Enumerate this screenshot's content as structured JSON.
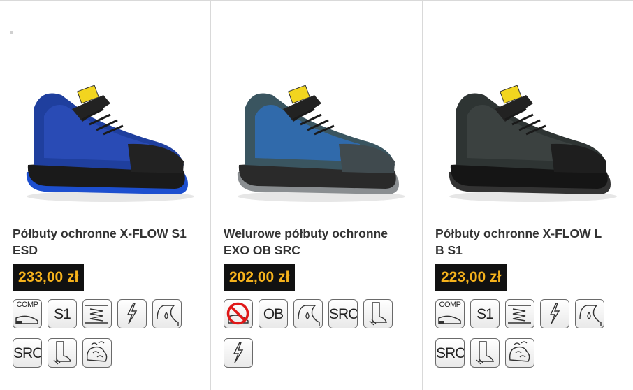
{
  "products": [
    {
      "title_line1": "Półbuty ochronne X-FLOW S1",
      "title_line2": "ESD",
      "price": "233,00 zł",
      "shoe_colors": {
        "upper": "#1f3f9e",
        "mesh": "#2b4db8",
        "sole": "#1a1a1a",
        "accent": "#1d4fcf",
        "toe": "#222222"
      },
      "icons": [
        {
          "name": "comp-toe-cap-icon",
          "label": "COMP"
        },
        {
          "name": "s1-standard-icon",
          "label": "S1"
        },
        {
          "name": "antistatic-sole-icon",
          "label": ""
        },
        {
          "name": "esd-lightning-icon",
          "label": ""
        },
        {
          "name": "water-drop-icon",
          "label": ""
        },
        {
          "name": "src-slip-resistance-icon",
          "label": "SRC"
        },
        {
          "name": "boot-energy-absorption-icon",
          "label": ""
        },
        {
          "name": "breathable-icon",
          "label": ""
        }
      ]
    },
    {
      "title_line1": "Welurowe półbuty ochronne",
      "title_line2": "EXO OB SRC",
      "price": "202,00 zł",
      "shoe_colors": {
        "upper": "#3a5560",
        "mesh": "#2f6fb8",
        "sole": "#2a2a2a",
        "accent": "#8a8e91",
        "toe": "#404a4e"
      },
      "icons": [
        {
          "name": "no-metal-icon",
          "label": ""
        },
        {
          "name": "ob-standard-icon",
          "label": "OB"
        },
        {
          "name": "water-drop-icon",
          "label": ""
        },
        {
          "name": "src-slip-resistance-icon",
          "label": "SRC"
        },
        {
          "name": "boot-energy-absorption-icon",
          "label": ""
        },
        {
          "name": "esd-lightning-icon",
          "label": ""
        }
      ]
    },
    {
      "title_line1": "Półbuty ochronne X-FLOW L",
      "title_line2": "B S1",
      "price": "223,00 zł",
      "shoe_colors": {
        "upper": "#2e3433",
        "mesh": "#3d4443",
        "sole": "#151515",
        "accent": "#333333",
        "toe": "#1e1e1e"
      },
      "icons": [
        {
          "name": "comp-toe-cap-icon",
          "label": "COMP"
        },
        {
          "name": "s1-standard-icon",
          "label": "S1"
        },
        {
          "name": "antistatic-sole-icon",
          "label": ""
        },
        {
          "name": "esd-lightning-icon",
          "label": ""
        },
        {
          "name": "water-drop-icon",
          "label": ""
        },
        {
          "name": "src-slip-resistance-icon",
          "label": "SRC"
        },
        {
          "name": "boot-energy-absorption-icon",
          "label": ""
        },
        {
          "name": "breathable-icon",
          "label": ""
        }
      ]
    }
  ]
}
